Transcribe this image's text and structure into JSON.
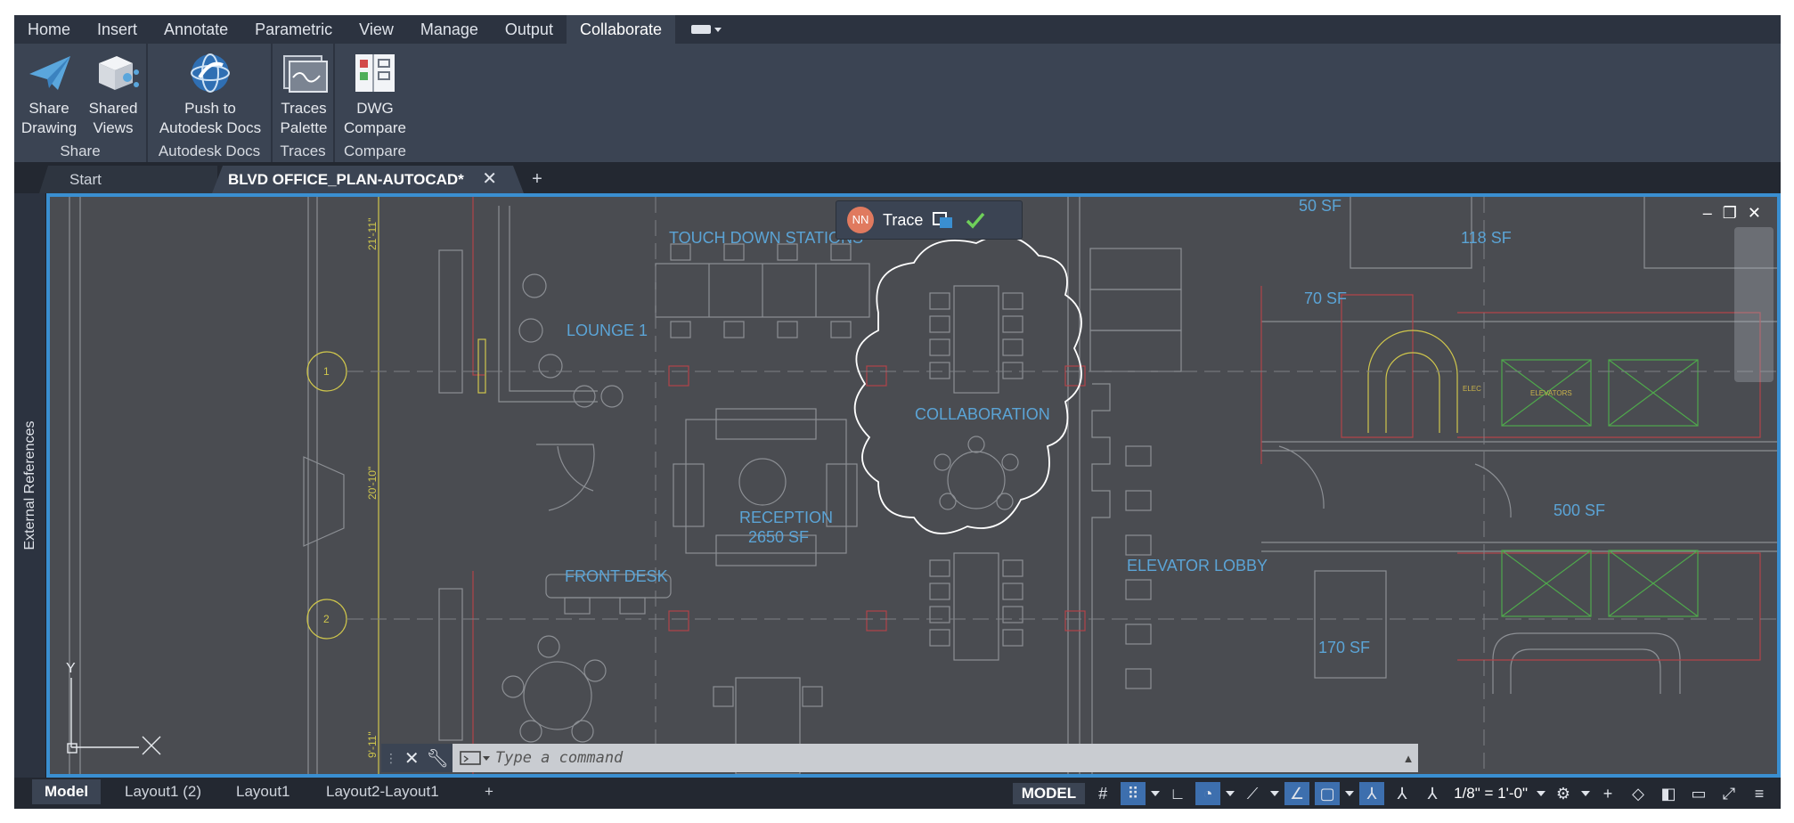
{
  "ribbon_tabs": [
    "Home",
    "Insert",
    "Annotate",
    "Parametric",
    "View",
    "Manage",
    "Output",
    "Collaborate"
  ],
  "active_tab": "Collaborate",
  "ribbon": {
    "share_drawing": "Share Drawing",
    "shared_views": "Shared Views",
    "push_to_docs": "Push to Autodesk Docs",
    "traces_palette": "Traces Palette",
    "dwg_compare": "DWG Compare",
    "panel_share": "Share",
    "panel_docs": "Autodesk Docs",
    "panel_traces": "Traces",
    "panel_compare": "Compare"
  },
  "file_tabs": {
    "start": "Start",
    "active": "BLVD OFFICE_PLAN-AUTOCAD*",
    "close": "✕",
    "add": "+"
  },
  "side_palette": "External References",
  "trace_bar": {
    "initials": "NN",
    "label": "Trace",
    "avatar_color": "#e07a5f"
  },
  "plan_labels": {
    "touch_down": "TOUCH DOWN STATIONS",
    "lounge": "LOUNGE 1",
    "collaboration": "COLLABORATION",
    "reception": "RECEPTION",
    "reception_area": "2650 SF",
    "front_desk": "FRONT DESK",
    "elevator_lobby": "ELEVATOR LOBBY",
    "area_50": "50 SF",
    "area_118": "118 SF",
    "area_70": "70 SF",
    "area_500": "500 SF",
    "area_170": "170 SF",
    "elec": "ELEC",
    "elevators": "ELEVATORS",
    "grid_1": "1",
    "grid_2": "2",
    "dim_top": "21'-11\"",
    "dim_mid": "20'-10\"",
    "dim_bottom": "9'-11\"",
    "axis_y": "Y"
  },
  "command_line": {
    "placeholder": "Type a command"
  },
  "layout_tabs": [
    "Model",
    "Layout1 (2)",
    "Layout1",
    "Layout2-Layout1",
    "+"
  ],
  "status": {
    "model": "MODEL",
    "scale": "1/8\" = 1'-0\""
  },
  "colors": {
    "accent": "#3a8fd1",
    "ribbon_bg": "#3b4453",
    "canvas": "#4a4c51",
    "label_blue": "#5ba4d6"
  }
}
